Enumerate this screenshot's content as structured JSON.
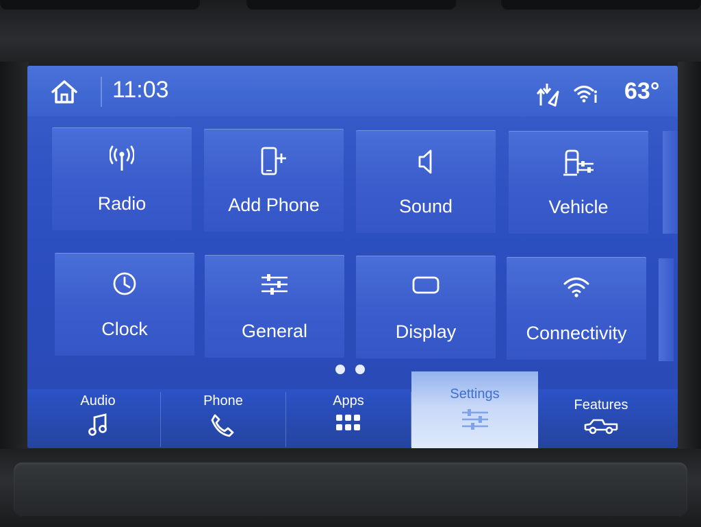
{
  "status_bar": {
    "time": "11:03",
    "temperature": "63°",
    "icons": [
      "home-icon",
      "navigation-arrows-icon",
      "wifi-hotspot-icon"
    ]
  },
  "settings_tiles": [
    {
      "label": "Radio",
      "icon": "radio-antenna-icon"
    },
    {
      "label": "Add Phone",
      "icon": "add-phone-icon"
    },
    {
      "label": "Sound",
      "icon": "speaker-icon"
    },
    {
      "label": "Vehicle",
      "icon": "vehicle-settings-icon"
    },
    {
      "label": "Clock",
      "icon": "clock-icon"
    },
    {
      "label": "General",
      "icon": "sliders-icon"
    },
    {
      "label": "Display",
      "icon": "display-icon"
    },
    {
      "label": "Connectivity",
      "icon": "wifi-icon"
    }
  ],
  "page_indicator": {
    "pages": 2
  },
  "bottom_nav": [
    {
      "label": "Audio",
      "icon": "music-note-icon"
    },
    {
      "label": "Phone",
      "icon": "phone-handset-icon"
    },
    {
      "label": "Apps",
      "icon": "apps-grid-icon"
    },
    {
      "label": "Settings",
      "icon": "settings-sliders-icon",
      "active": true
    },
    {
      "label": "Features",
      "icon": "truck-icon"
    }
  ],
  "colors": {
    "screen_background": "#2f53c3",
    "tile": "#4366d4",
    "active_tab": "#dfe9fb",
    "active_tab_text": "#3d6fd2"
  }
}
